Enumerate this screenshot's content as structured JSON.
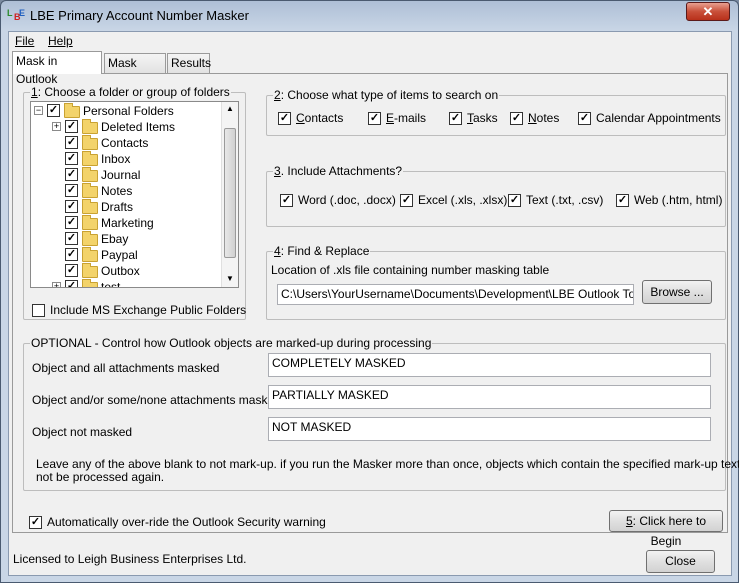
{
  "window": {
    "title": "LBE Primary Account Number Masker",
    "icon": "lbe-app-icon",
    "close_glyph": "✕"
  },
  "menu": {
    "file": "File",
    "help": "Help"
  },
  "tabs": [
    {
      "label": "Mask in Outlook",
      "active": true
    },
    {
      "label": "Mask Files",
      "active": false
    },
    {
      "label": "Results",
      "active": false
    }
  ],
  "folders_group": {
    "legend_num": "1",
    "legend_text": ": Choose a folder or group of folders",
    "tree": [
      {
        "label": "Personal Folders",
        "level": 0,
        "checked": true,
        "expand": "minus"
      },
      {
        "label": "Deleted Items",
        "level": 1,
        "checked": true,
        "expand": "plus"
      },
      {
        "label": "Contacts",
        "level": 1,
        "checked": true,
        "expand": ""
      },
      {
        "label": "Inbox",
        "level": 1,
        "checked": true,
        "expand": ""
      },
      {
        "label": "Journal",
        "level": 1,
        "checked": true,
        "expand": ""
      },
      {
        "label": "Notes",
        "level": 1,
        "checked": true,
        "expand": ""
      },
      {
        "label": "Drafts",
        "level": 1,
        "checked": true,
        "expand": ""
      },
      {
        "label": "Marketing",
        "level": 1,
        "checked": true,
        "expand": ""
      },
      {
        "label": "Ebay",
        "level": 1,
        "checked": true,
        "expand": ""
      },
      {
        "label": "Paypal",
        "level": 1,
        "checked": true,
        "expand": ""
      },
      {
        "label": "Outbox",
        "level": 1,
        "checked": true,
        "expand": ""
      },
      {
        "label": "test",
        "level": 1,
        "checked": true,
        "expand": "plus"
      }
    ],
    "exchange_label": "Include MS Exchange  Public Folders",
    "exchange_checked": false
  },
  "item_types": {
    "legend_num": "2",
    "legend_text": ": Choose what type of items to search on",
    "items": [
      {
        "label": "Contacts",
        "ul": "C",
        "rest": "ontacts",
        "checked": true
      },
      {
        "label": "E-mails",
        "ul": "E",
        "rest": "-mails",
        "checked": true
      },
      {
        "label": "Tasks",
        "ul": "T",
        "rest": "asks",
        "checked": true
      },
      {
        "label": "Notes",
        "ul": "N",
        "rest": "otes",
        "checked": true
      },
      {
        "label": "Calendar Appointments",
        "ul": "",
        "rest": "Calendar Appointments",
        "checked": true
      }
    ]
  },
  "attachments": {
    "legend_num": "3",
    "legend_text": ". Include Attachments?",
    "items": [
      {
        "label": "Word (.doc, .docx)",
        "checked": true
      },
      {
        "label": "Excel (.xls, .xlsx)",
        "checked": true
      },
      {
        "label": "Text (.txt, .csv)",
        "checked": true
      },
      {
        "label": "Web (.htm, html)",
        "checked": true
      }
    ]
  },
  "find_replace": {
    "legend_num": "4",
    "legend_text": ": Find & Replace",
    "location_label": "Location of .xls file containing number masking table",
    "path_value": "C:\\Users\\YourUsername\\Documents\\Development\\LBE Outlook Tools\\PAN",
    "browse_label": "Browse ..."
  },
  "optional": {
    "legend": "OPTIONAL - Control how Outlook objects are marked-up during processing",
    "rows": [
      {
        "label": "Object and all attachments masked",
        "value": "COMPLETELY MASKED"
      },
      {
        "label": "Object and/or some/none  attachments masked",
        "value": "PARTIALLY MASKED"
      },
      {
        "label": "Object not masked",
        "value": "NOT MASKED"
      }
    ],
    "note_line1": "Leave any of the above blank to not mark-up.  if you run the Masker more than once, objects which contain the specified mark-up text will",
    "note_line2": "not be processed again."
  },
  "security": {
    "label": "Automatically over-ride the Outlook Security warning",
    "checked": true
  },
  "begin_button": {
    "num": "5",
    "text": ": Click here to Begin"
  },
  "footer": {
    "license": "Licensed to Leigh Business Enterprises Ltd.",
    "close_label": "Close"
  }
}
